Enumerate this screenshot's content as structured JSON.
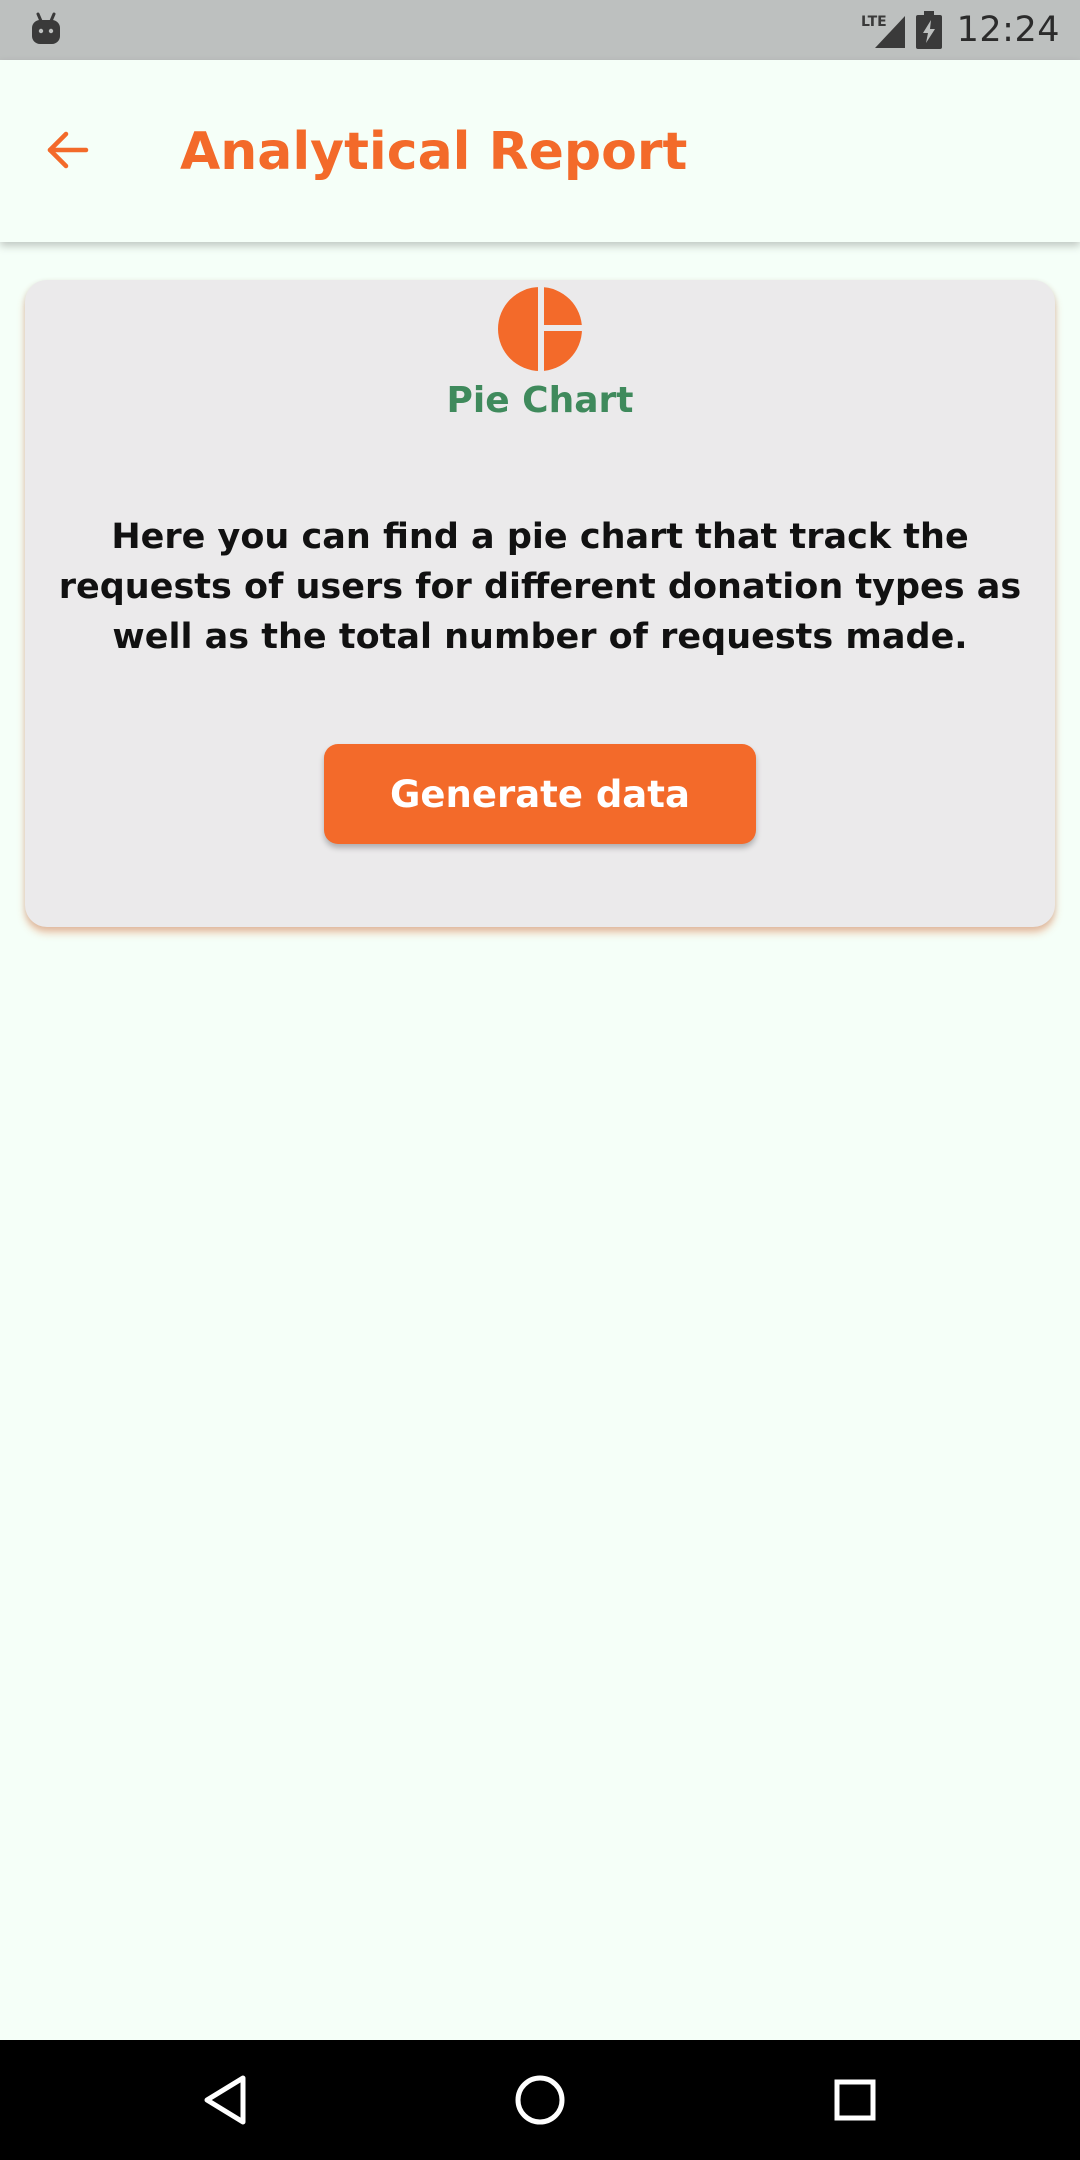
{
  "status_bar": {
    "time": "12:24",
    "network_label": "LTE",
    "icons": [
      "android-debug-icon",
      "lte-signal-icon",
      "battery-charging-icon"
    ]
  },
  "app_bar": {
    "title": "Analytical Report",
    "back_icon": "arrow-back-icon"
  },
  "card": {
    "icon": "pie-chart-icon",
    "title": "Pie Chart",
    "description": "Here you can find a pie chart that track the requests of users for different donation types as well as the total number of requests made.",
    "button_label": "Generate data"
  },
  "nav_bar": {
    "icons": [
      "back-triangle-icon",
      "home-circle-icon",
      "recents-square-icon"
    ]
  },
  "colors": {
    "accent": "#f36a2a",
    "title_green": "#3f8a5c",
    "background": "#f5fff8",
    "card": "#ebeaeb",
    "status_bar": "#bdc0bf"
  }
}
